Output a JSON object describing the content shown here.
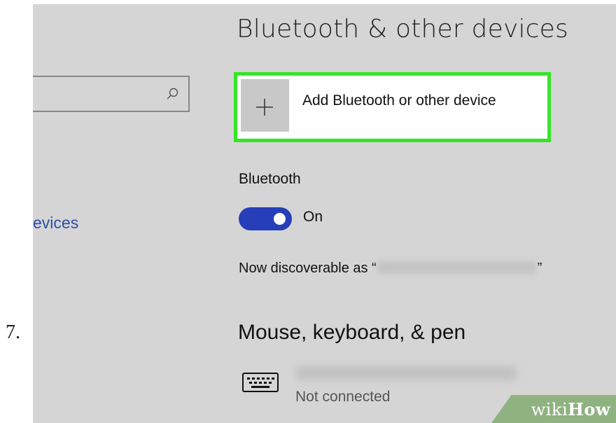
{
  "step": {
    "number": "7."
  },
  "settings": {
    "title": "Bluetooth & other devices",
    "sidebar": {
      "devices_link": "evices"
    },
    "add_device": {
      "label": "Add Bluetooth or other device",
      "icon": "plus-icon"
    },
    "bluetooth": {
      "heading": "Bluetooth",
      "toggle_state": "On",
      "discoverable_prefix": "Now discoverable as “",
      "discoverable_suffix": "”"
    },
    "mouse_keyboard_pen": {
      "heading": "Mouse, keyboard, & pen",
      "device_status": "Not connected",
      "icon": "keyboard-icon"
    }
  },
  "watermark": {
    "wiki": "wiki",
    "how": "How"
  },
  "colors": {
    "panel_background": "#d5d5d5",
    "highlight_border": "#35e626",
    "toggle_on": "#263fb8",
    "link_text": "#2d4fa3",
    "watermark_green": "#8fb281"
  }
}
